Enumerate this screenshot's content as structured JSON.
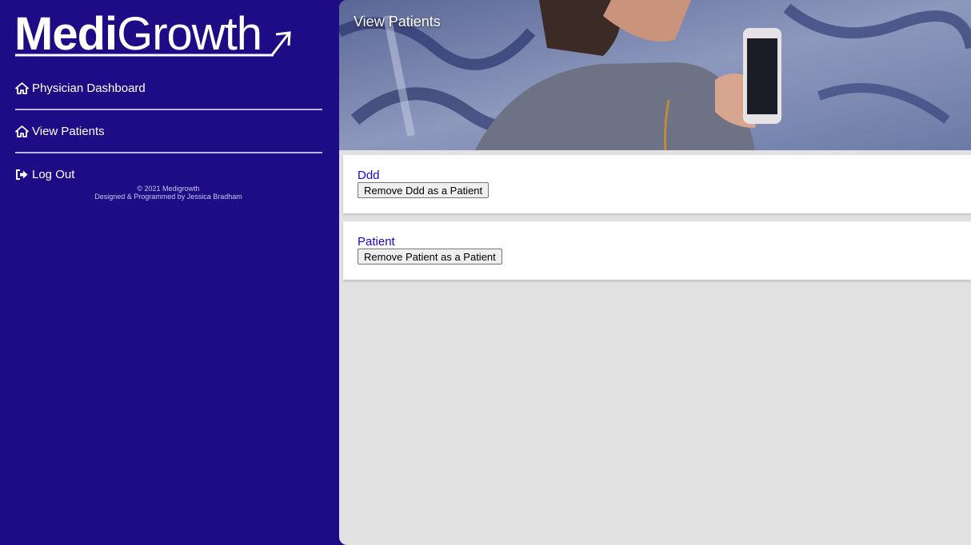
{
  "brand": {
    "logo_bold": "Medi",
    "logo_light": "Growth"
  },
  "sidebar": {
    "items": [
      {
        "label": "Physician Dashboard",
        "icon": "home-icon"
      },
      {
        "label": "View Patients",
        "icon": "home-icon"
      },
      {
        "label": "Log Out",
        "icon": "sign-out-icon"
      }
    ],
    "footer_line1": "© 2021 Medigrowth",
    "footer_line2": "Designed & Programmed by Jessica Bradham"
  },
  "header": {
    "title": "View Patients"
  },
  "patients": [
    {
      "name": "Ddd",
      "remove_label": "Remove Ddd as a Patient"
    },
    {
      "name": "Patient",
      "remove_label": "Remove Patient as a Patient"
    }
  ],
  "colors": {
    "sidebar_bg": "#1e0b86",
    "link": "#2200cc",
    "content_bg": "#e2e2e2"
  }
}
